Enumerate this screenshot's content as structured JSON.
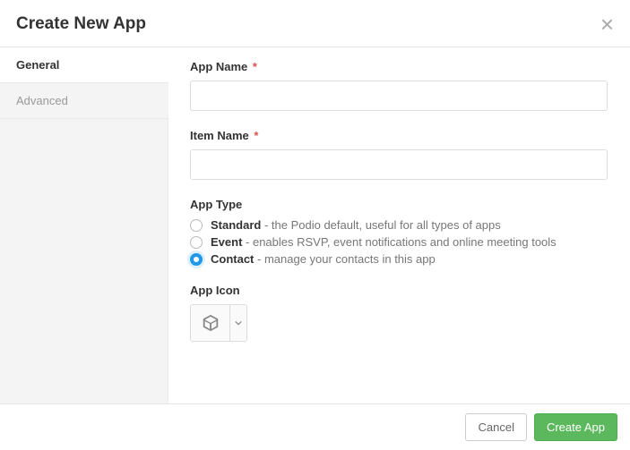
{
  "header": {
    "title": "Create New App"
  },
  "sidebar": {
    "items": [
      {
        "label": "General",
        "active": true
      },
      {
        "label": "Advanced",
        "active": false
      }
    ]
  },
  "form": {
    "app_name": {
      "label": "App Name",
      "required_mark": "*",
      "value": ""
    },
    "item_name": {
      "label": "Item Name",
      "required_mark": "*",
      "value": ""
    },
    "app_type": {
      "label": "App Type",
      "options": [
        {
          "name": "Standard",
          "desc": " - the Podio default, useful for all types of apps",
          "checked": false
        },
        {
          "name": "Event",
          "desc": " - enables RSVP, event notifications and online meeting tools",
          "checked": false
        },
        {
          "name": "Contact",
          "desc": " - manage your contacts in this app",
          "checked": true
        }
      ]
    },
    "app_icon": {
      "label": "App Icon",
      "icon": "cube-icon"
    }
  },
  "footer": {
    "cancel": "Cancel",
    "submit": "Create App"
  }
}
